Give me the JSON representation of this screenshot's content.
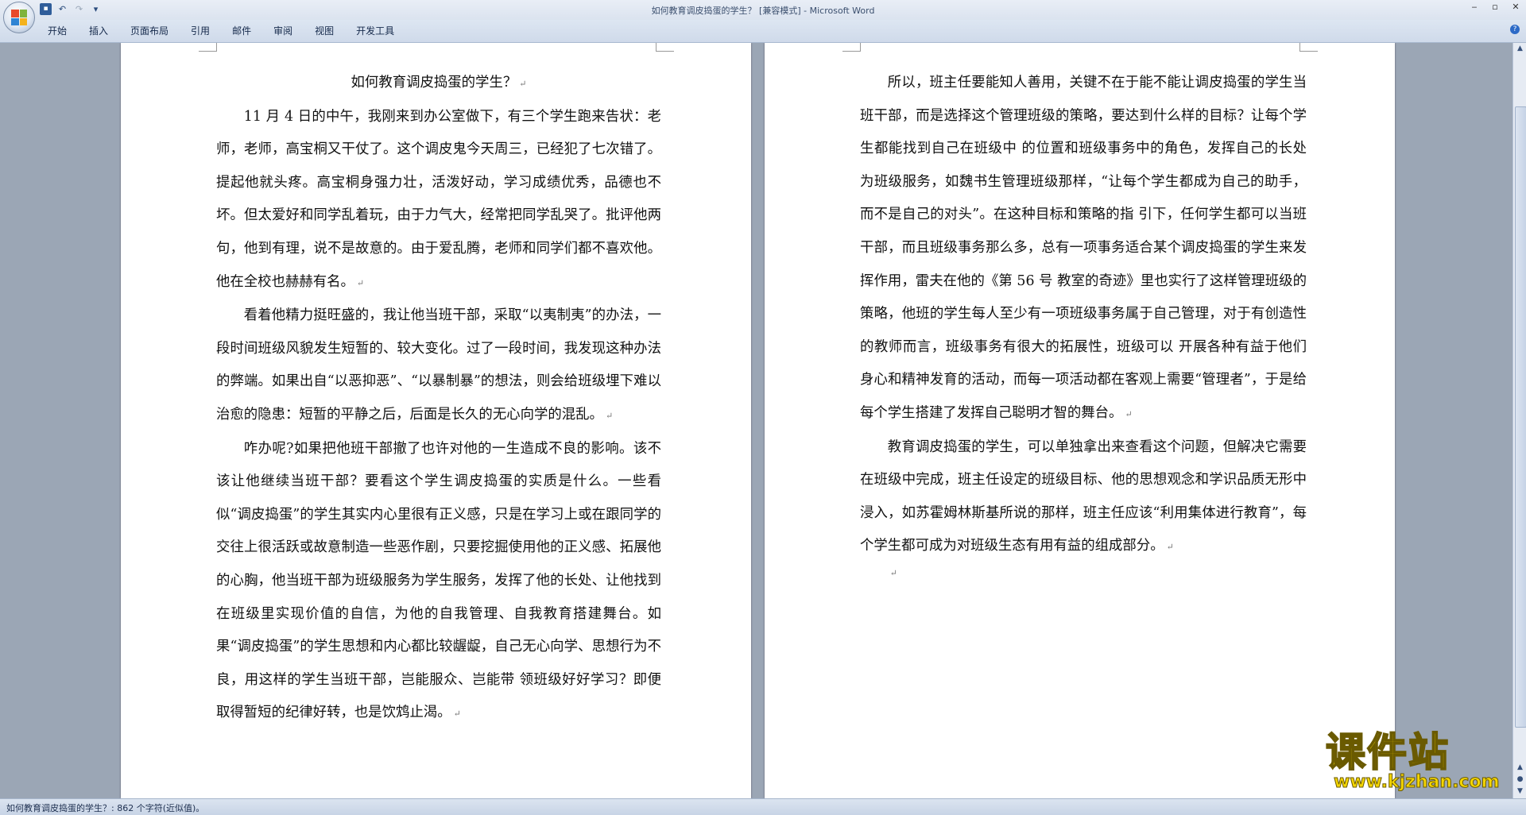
{
  "window": {
    "title": "如何教育调皮捣蛋的学生？ [兼容模式] - Microsoft Word",
    "controls": [
      "‒",
      "▫",
      "✕"
    ]
  },
  "quick_access": {
    "save_icon": "save-icon",
    "undo_icon": "undo-icon",
    "redo_icon": "redo-icon",
    "customize_icon": "dropdown-icon"
  },
  "ribbon": {
    "tabs": [
      "开始",
      "插入",
      "页面布局",
      "引用",
      "邮件",
      "审阅",
      "视图",
      "开发工具"
    ]
  },
  "document": {
    "title": "如何教育调皮捣蛋的学生？",
    "left_paragraphs": [
      "11 月 4 日的中午，我刚来到办公室做下，有三个学生跑来告状：老师，老师，高宝桐又干仗了。这个调皮鬼今天周三，已经犯了七次错了。提起他就头疼。高宝桐身强力壮，活泼好动，学习成绩优秀，品德也不坏。但太爱好和同学乱着玩，由于力气大，经常把同学乱哭了。批评他两句，他到有理，说不是故意的。由于爱乱腾，老师和同学们都不喜欢他。他在全校也赫赫有名。",
      "看着他精力挺旺盛的，我让他当班干部，采取“以夷制夷”的办法，一段时间班级风貌发生短暂的、较大变化。过了一段时间，我发现这种办法的弊端。如果出自“以恶抑恶”、“以暴制暴”的想法，则会给班级埋下难以治愈的隐患：短暂的平静之后，后面是长久的无心向学的混乱。",
      "咋办呢?如果把他班干部撤了也许对他的一生造成不良的影响。该不该让他继续当班干部？要看这个学生调皮捣蛋的实质是什么。一些看似“调皮捣蛋”的学生其实内心里很有正义感，只是在学习上或在跟同学的交往上很活跃或故意制造一些恶作剧，只要挖掘使用他的正义感、拓展他的心胸，他当班干部为班级服务为学生服务，发挥了他的长处、让他找到在班级里实现价值的自信，为他的自我管理、自我教育搭建舞台。如果“调皮捣蛋”的学生思想和内心都比较龌龊，自己无心向学、思想行为不良，用这样的学生当班干部，岂能服众、岂能带  领班级好好学习？即便取得暂短的纪律好转，也是饮鸩止渴。"
    ],
    "right_paragraphs": [
      "所以，班主任要能知人善用，关键不在于能不能让调皮捣蛋的学生当班干部，而是选择这个管理班级的策略，要达到什么样的目标？让每个学生都能找到自己在班级中 的位置和班级事务中的角色，发挥自己的长处为班级服务，如魏书生管理班级那样，“让每个学生都成为自己的助手，而不是自己的对头”。在这种目标和策略的指 引下，任何学生都可以当班干部，而且班级事务那么多，总有一项事务适合某个调皮捣蛋的学生来发挥作用，雷夫在他的《第 56 号  教室的奇迹》里也实行了这样管理班级的策略，他班的学生每人至少有一项班级事务属于自己管理，对于有创造性的教师而言，班级事务有很大的拓展性，班级可以 开展各种有益于他们身心和精神发育的活动，而每一项活动都在客观上需要“管理者”，于是给每个学生搭建了发挥自己聪明才智的舞台。",
      "教育调皮捣蛋的学生，可以单独拿出来查看这个问题，但解决它需要在班级中完成，班主任设定的班级目标、他的思想观念和学识品质无形中浸入，如苏霍姆林斯基所说的那样，班主任应该“利用集体进行教育”，每个学生都可成为对班级生态有用有益的组成部分。"
    ],
    "paragraph_mark": "↵"
  },
  "status_bar": {
    "text": "如何教育调皮捣蛋的学生？: 862 个字符(近似值)。"
  },
  "watermark": {
    "cn": "课件站",
    "url": "www.kjzhan.com"
  },
  "colors": {
    "accent": "#2f5d9a",
    "workspace": "#9ba6b5",
    "watermark": "#f5d600"
  }
}
